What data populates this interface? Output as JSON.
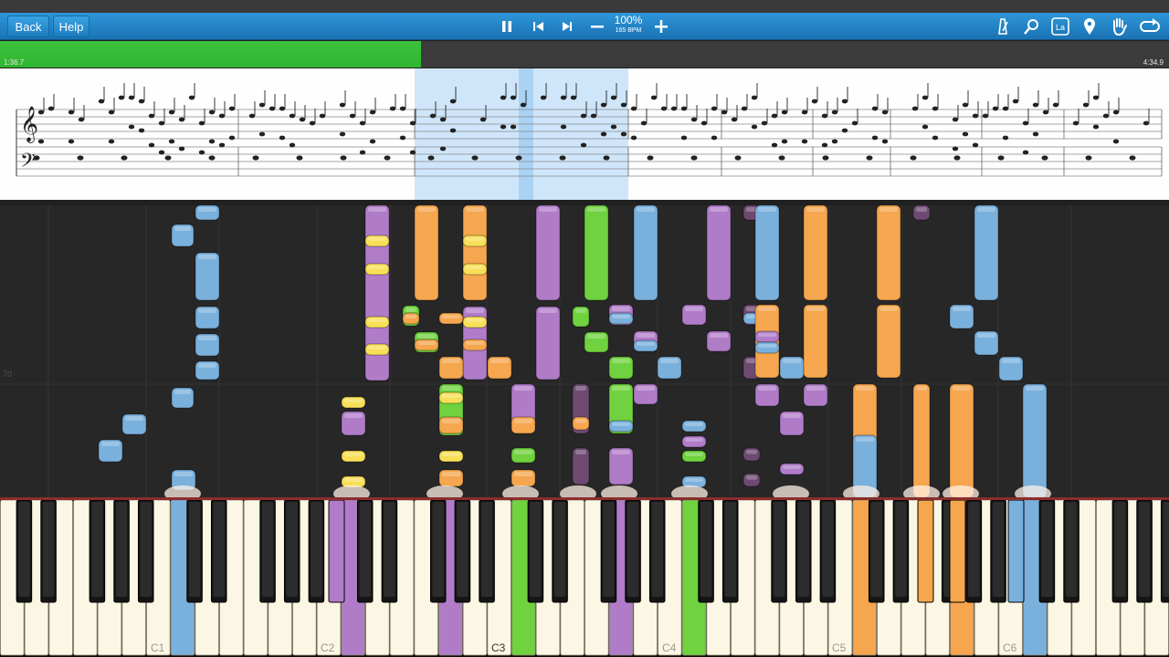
{
  "toolbar": {
    "back_label": "Back",
    "help_label": "Help",
    "tempo_percent": "100%",
    "tempo_bpm": "165 BPM",
    "icons": [
      "pause-icon",
      "skip-back-icon",
      "skip-forward-icon",
      "minus-icon",
      "plus-icon",
      "metronome-icon",
      "zoom-icon",
      "key-label-icon",
      "marker-icon",
      "hand-icon",
      "loop-icon"
    ]
  },
  "progress": {
    "elapsed": "1:36.7",
    "total": "4:34.9",
    "fraction": 0.36,
    "colors": {
      "played": "#2fb52f",
      "remaining": "#3b3b3b"
    }
  },
  "roll": {
    "row_label": "70",
    "colors": {
      "blue": "#7ab0dc",
      "purple": "#b07cc8",
      "orange": "#f5a64e",
      "green": "#6fd23e",
      "yellow": "#f7df58",
      "dark_purple": "#6e4a72"
    }
  },
  "keyboard": {
    "octave_labels": [
      "C1",
      "C2",
      "C3",
      "C4",
      "C5",
      "C6"
    ]
  }
}
